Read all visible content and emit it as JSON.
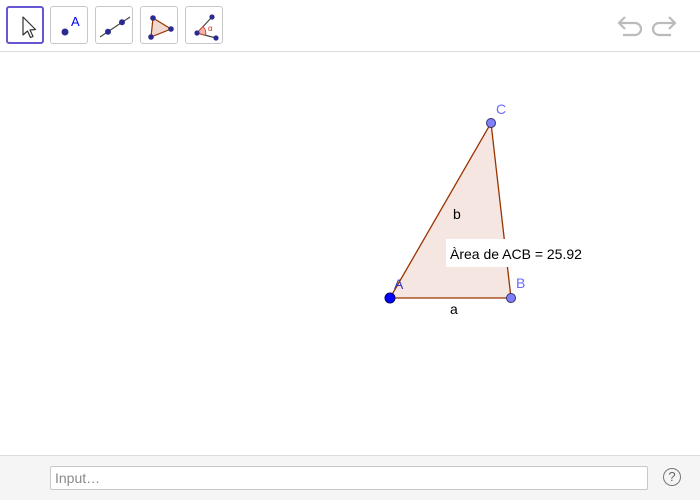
{
  "toolbar": {
    "tools": [
      {
        "name": "Move",
        "icon": "arrow-cursor-icon",
        "active": true
      },
      {
        "name": "Point",
        "icon": "point-icon",
        "label": "A"
      },
      {
        "name": "Line",
        "icon": "line-icon"
      },
      {
        "name": "Polygon",
        "icon": "polygon-icon"
      },
      {
        "name": "Angle",
        "icon": "angle-icon",
        "label": "α"
      }
    ],
    "undo_icon": "undo-icon",
    "redo_icon": "redo-icon"
  },
  "graphics": {
    "points": {
      "A": "A",
      "B": "B",
      "C": "C"
    },
    "segments": {
      "a": "a",
      "b": "b"
    },
    "area_text": "Àrea de  ACB = 25.92"
  },
  "input_bar": {
    "placeholder": "Input…",
    "help_label": "?"
  },
  "colors": {
    "accent": "#6557d2",
    "point_free": "#0000ff",
    "point_dependent": "#7f7fff",
    "point_label": "#6b6bff",
    "polygon_fill": "#f5e6e2",
    "polygon_stroke": "#993300"
  }
}
